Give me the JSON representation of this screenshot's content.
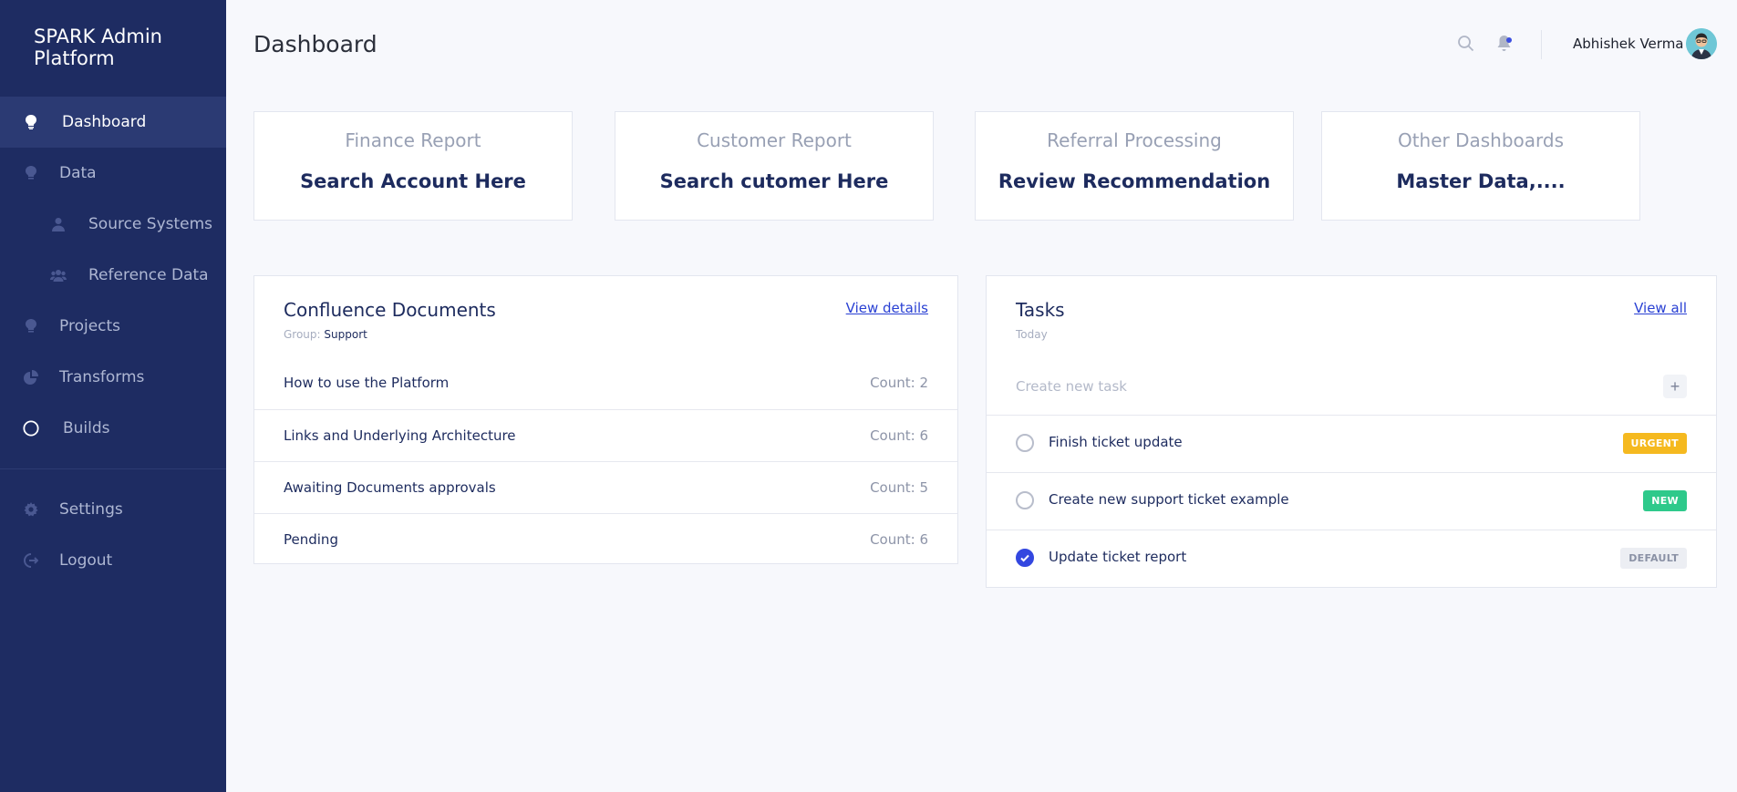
{
  "app": {
    "brand": "SPARK Admin Platform"
  },
  "sidebar": {
    "items": [
      {
        "label": "Dashboard",
        "icon": "lightbulb-icon"
      },
      {
        "label": "Data",
        "icon": "lightbulb-icon"
      },
      {
        "label": "Source Systems",
        "icon": "user-icon"
      },
      {
        "label": "Reference Data",
        "icon": "users-icon"
      },
      {
        "label": "Projects",
        "icon": "lightbulb-icon"
      },
      {
        "label": "Transforms",
        "icon": "pie-chart-icon"
      },
      {
        "label": "Builds",
        "icon": "circle-icon"
      },
      {
        "label": "Settings",
        "icon": "gear-icon"
      },
      {
        "label": "Logout",
        "icon": "logout-icon"
      }
    ]
  },
  "header": {
    "title": "Dashboard",
    "user_name": "Abhishek Verma",
    "search_icon": "search-icon",
    "bell_icon": "bell-icon"
  },
  "cards": [
    {
      "title": "Finance Report",
      "value": "Search Account Here"
    },
    {
      "title": "Customer Report",
      "value": "Search cutomer Here"
    },
    {
      "title": "Referral Processing",
      "value": "Review Recommendation"
    },
    {
      "title": "Other Dashboards",
      "value": "Master Data,...."
    }
  ],
  "documents": {
    "title": "Confluence Documents",
    "group_label": "Group:",
    "group_value": "Support",
    "link": "View details",
    "rows": [
      {
        "name": "How to use the Platform",
        "count": "Count: 2"
      },
      {
        "name": "Links and Underlying Architecture",
        "count": "Count: 6"
      },
      {
        "name": "Awaiting Documents approvals",
        "count": "Count: 5"
      },
      {
        "name": "Pending",
        "count": "Count: 6"
      }
    ]
  },
  "tasks": {
    "title": "Tasks",
    "subtitle": "Today",
    "link": "View all",
    "placeholder": "Create new task",
    "add_symbol": "+",
    "rows": [
      {
        "name": "Finish ticket update",
        "badge": "URGENT",
        "badge_color": "#f5b91f",
        "done": false
      },
      {
        "name": "Create new support ticket example",
        "badge": "NEW",
        "badge_color": "#2ec98b",
        "done": false
      },
      {
        "name": "Update ticket report",
        "badge": "DEFAULT",
        "badge_color": "#eceef3",
        "done": true
      }
    ]
  },
  "colors": {
    "sidebar_bg": "#1e2c62",
    "accent": "#2940d3"
  }
}
